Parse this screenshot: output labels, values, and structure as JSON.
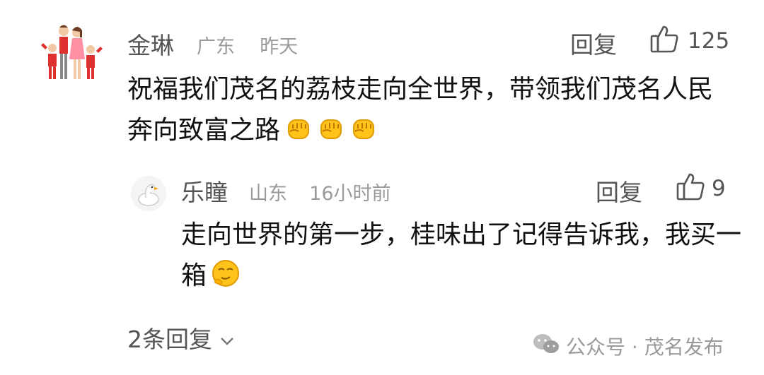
{
  "comment": {
    "author": "金琳",
    "location": "广东",
    "time": "昨天",
    "reply_label": "回复",
    "like_count": "125",
    "text": "祝福我们茂名的荔枝走向全世界，带领我们茂名人民奔向致富之路",
    "emojis": [
      "fist-emoji",
      "fist-emoji",
      "fist-emoji"
    ]
  },
  "reply": {
    "author": "乐瞳",
    "location": "山东",
    "time": "16小时前",
    "reply_label": "回复",
    "like_count": "9",
    "text": "走向世界的第一步，桂味出了记得告诉我，我买一箱",
    "emojis": [
      "smirk-emoji"
    ]
  },
  "more_replies": "2条回复",
  "footer": {
    "text": "公众号 · 茂名发布"
  },
  "colors": {
    "emoji_yellow": "#FFC31A",
    "meta_gray": "#9a9a9a"
  }
}
